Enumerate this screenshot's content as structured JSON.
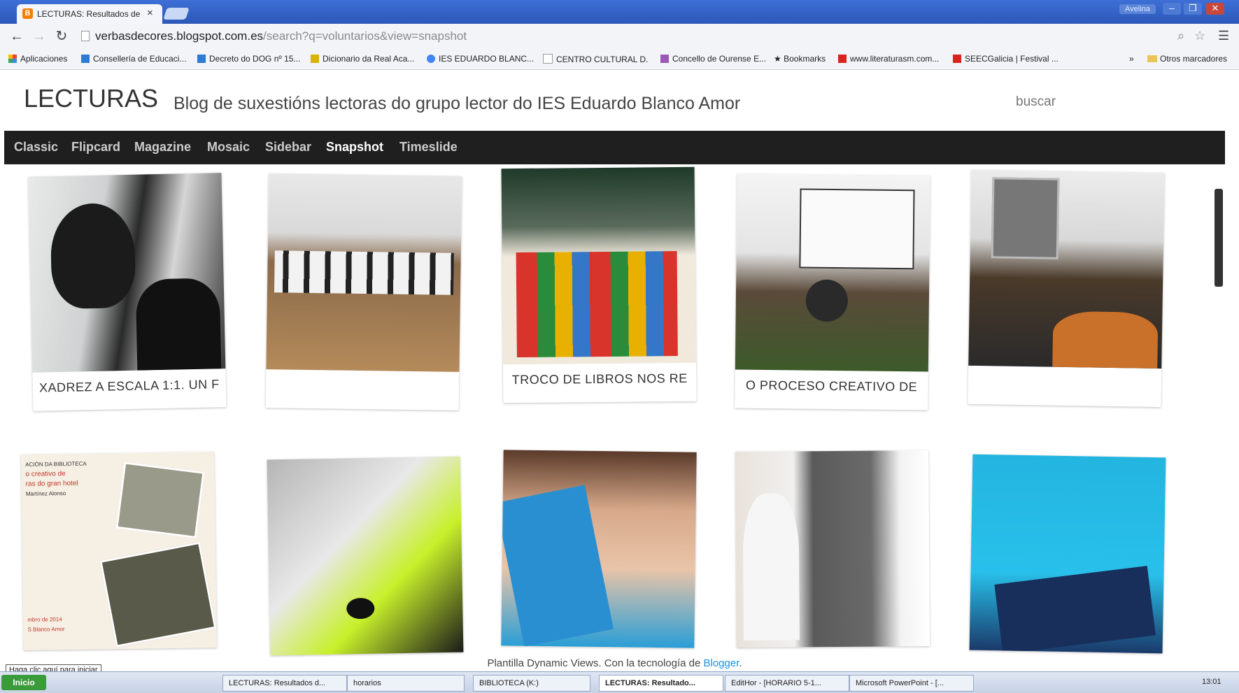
{
  "browser": {
    "tab_title": "LECTURAS: Resultados de l",
    "tab_close": "×",
    "user_label": "Avelina",
    "window_buttons": [
      "–",
      "❐",
      "✕"
    ],
    "nav": {
      "back": "←",
      "forward": "→",
      "reload": "↻",
      "menu": "☰",
      "zoom": "⌕",
      "star": "☆"
    },
    "url_host": "verbasdecores.blogspot.com.es",
    "url_path": "/search?q=voluntarios&view=snapshot",
    "bookmarks": [
      {
        "label": "Aplicaciones",
        "icon": "apps-icon",
        "color": "#e8453c"
      },
      {
        "label": "Consellería de Educaci...",
        "icon": "site-icon",
        "color": "#2e7bd6"
      },
      {
        "label": "Decreto do DOG nº 15...",
        "icon": "site-icon",
        "color": "#2e7bd6"
      },
      {
        "label": "Dicionario da Real Aca...",
        "icon": "dictionary-icon",
        "color": "#d9b300"
      },
      {
        "label": "IES EDUARDO BLANC...",
        "icon": "google-icon",
        "color": "#4285f4"
      },
      {
        "label": "CENTRO CULTURAL D...",
        "icon": "page-icon",
        "color": "#ffffff"
      },
      {
        "label": "Concello de Ourense E...",
        "icon": "site-icon",
        "color": "#9b59b6"
      },
      {
        "label": "Bookmarks",
        "icon": "star-icon",
        "color": "#333333"
      },
      {
        "label": "www.literaturasm.com...",
        "icon": "site-icon",
        "color": "#d7261e"
      },
      {
        "label": "SEECGalicia | Festival ...",
        "icon": "sg-icon",
        "color": "#d7261e"
      }
    ],
    "bookmarks_more": "»",
    "other_bookmarks": "Otros marcadores"
  },
  "blog": {
    "title": "LECTURAS",
    "description": "Blog de suxestións lectoras do grupo lector do IES Eduardo Blanco Amor",
    "search_placeholder": "buscar",
    "views": [
      "Classic",
      "Flipcard",
      "Magazine",
      "Mosaic",
      "Sidebar",
      "Snapshot",
      "Timeslide"
    ],
    "active_view": "Snapshot",
    "posts": [
      {
        "caption": "XADREZ A ESCALA 1:1. UN F"
      },
      {
        "caption": ""
      },
      {
        "caption": "TROCO DE LIBROS NOS RE"
      },
      {
        "caption": "O PROCESO CREATIVO DE"
      },
      {
        "caption": ""
      },
      {
        "caption": ""
      },
      {
        "caption": ""
      },
      {
        "caption": ""
      },
      {
        "caption": ""
      },
      {
        "caption": ""
      }
    ],
    "footer_text": "Plantilla Dynamic Views. Con la tecnología de",
    "footer_link": "Blogger",
    "poster_lines": [
      "ACIÓN DA BIBLIOTECA",
      "o creativo de",
      "ras do gran hotel",
      "Martínez Alonso",
      "mbro de 2014",
      "S Blanco Amor"
    ]
  },
  "taskbar": {
    "tooltip": "Haga clic aquí para iniciar",
    "start": "Inicio",
    "tasks": [
      {
        "label": "LECTURAS: Resultados d...",
        "active": false
      },
      {
        "label": "horarios",
        "active": false
      },
      {
        "label": "BIBLIOTECA (K:)",
        "active": false
      },
      {
        "label": "LECTURAS: Resultado...",
        "active": true
      },
      {
        "label": "EditHor - [HORARIO 5-1...",
        "active": false
      },
      {
        "label": "Microsoft PowerPoint - [...",
        "active": false
      }
    ],
    "clock": "13:01"
  },
  "colors": {
    "titlebar": "#2c58b8",
    "nav_bar": "#1f1f1f",
    "link": "#1f8de0",
    "blogger_orange": "#f57d00"
  }
}
